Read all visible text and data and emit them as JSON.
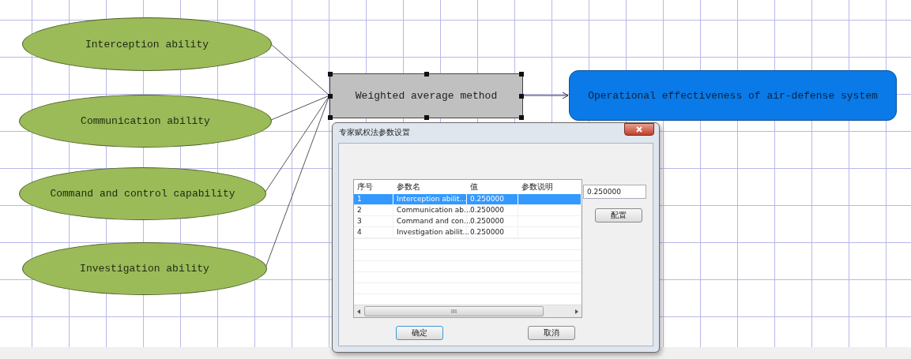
{
  "diagram": {
    "inputs": [
      {
        "label": "Interception ability"
      },
      {
        "label": "Communication ability"
      },
      {
        "label": "Command and control capability"
      },
      {
        "label": "Investigation ability"
      }
    ],
    "method": {
      "label": "Weighted average method",
      "selected": true
    },
    "output": {
      "label": "Operational effectiveness of air-defense system"
    }
  },
  "dialog": {
    "title": "专家赋权法参数设置",
    "table": {
      "columns": [
        "序号",
        "参数名",
        "值",
        "参数说明"
      ],
      "rows": [
        {
          "cells": [
            "1",
            "Interception abilit...",
            "0.250000",
            ""
          ],
          "selected": true
        },
        {
          "cells": [
            "2",
            "Communication ab...",
            "0.250000",
            ""
          ],
          "selected": false
        },
        {
          "cells": [
            "3",
            "Command and con...",
            "0.250000",
            ""
          ],
          "selected": false
        },
        {
          "cells": [
            "4",
            "Investigation abilit...",
            "0.250000",
            ""
          ],
          "selected": false
        }
      ]
    },
    "value_field": {
      "value": "0.250000"
    },
    "configure_button": "配置",
    "ok_button": "确定",
    "cancel_button": "取消"
  }
}
